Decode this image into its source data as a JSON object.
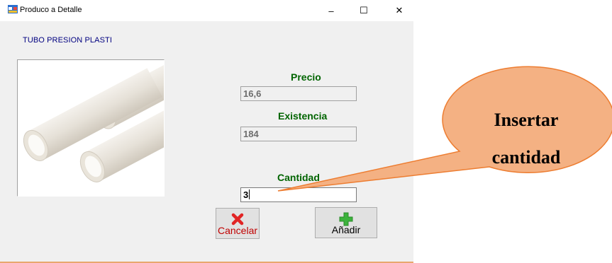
{
  "window": {
    "title": "Produco a Detalle",
    "controls": {
      "minimize": "–",
      "maximize": "☐",
      "close": "✕"
    }
  },
  "product": {
    "name": "TUBO  PRESION PLASTI",
    "image": "pvc-pipes-image"
  },
  "fields": {
    "precio": {
      "label": "Precio",
      "value": "16,6"
    },
    "existencia": {
      "label": "Existencia",
      "value": "184"
    },
    "cantidad": {
      "label": "Cantidad",
      "value": "3"
    }
  },
  "buttons": {
    "cancelar": {
      "label": "Cancelar",
      "icon": "red-x-icon"
    },
    "anadir": {
      "label": "Añadir",
      "icon": "green-plus-icon"
    }
  },
  "callout": {
    "line1": "Insertar",
    "line2": "cantidad",
    "fill": "#f4b183",
    "stroke": "#ed7d31"
  },
  "colors": {
    "label_green": "#006400",
    "product_blue": "#000080",
    "window_bg": "#f0f0f0"
  }
}
